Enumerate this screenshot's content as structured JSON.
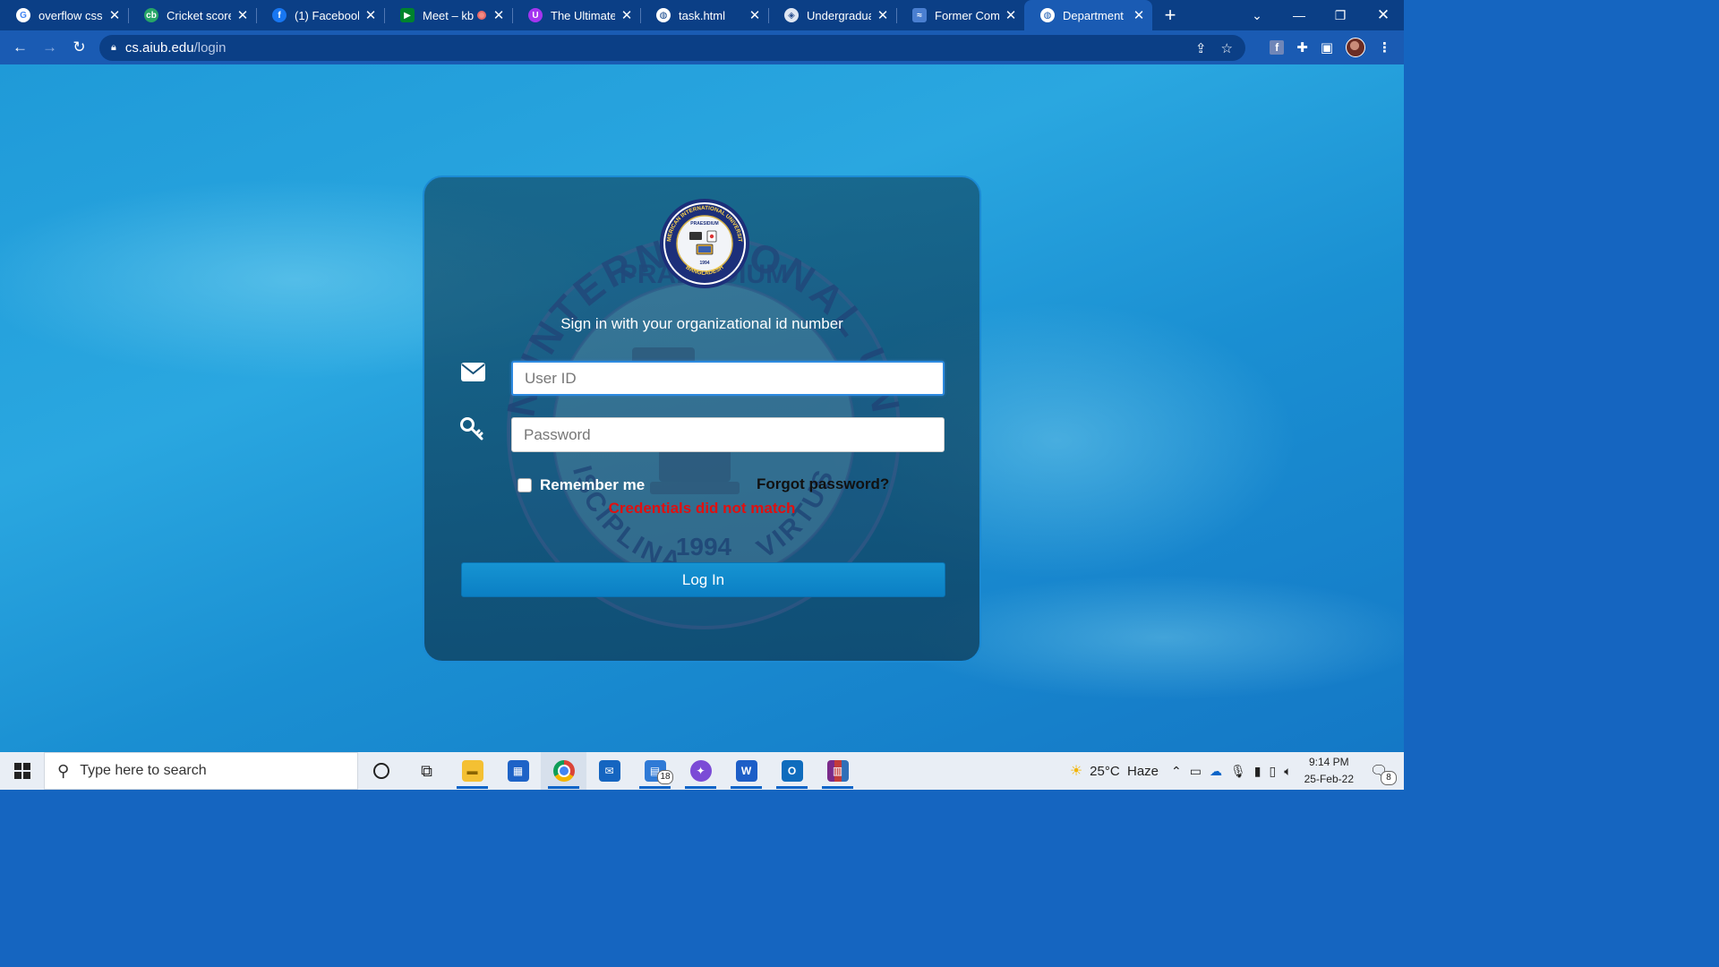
{
  "browser": {
    "tabs": [
      {
        "title": "overflow css -",
        "icon": "google-icon",
        "color": "#ffffff"
      },
      {
        "title": "Cricket scorec",
        "icon": "cricbuzz-icon",
        "color": "#27a567"
      },
      {
        "title": "(1) Facebook",
        "icon": "facebook-icon",
        "color": "#1877f2"
      },
      {
        "title": "Meet – kb",
        "icon": "google-meet-icon",
        "color": "#00832d"
      },
      {
        "title": "The Ultimate 2",
        "icon": "udemy-icon",
        "color": "#a435f0"
      },
      {
        "title": "task.html",
        "icon": "globe-icon",
        "color": "#ffffff"
      },
      {
        "title": "Undergraduat",
        "icon": "university-icon",
        "color": "#dfe6f2"
      },
      {
        "title": "Former Comm",
        "icon": "site-icon",
        "color": "#4a7fd1"
      },
      {
        "title": "Department o",
        "icon": "globe-icon",
        "color": "#ffffff",
        "active": true
      }
    ],
    "url_host": "cs.aiub.edu",
    "url_path": "/login"
  },
  "login": {
    "subtitle": "Sign in with your organizational id number",
    "user_placeholder": "User ID",
    "password_placeholder": "Password",
    "remember_label": "Remember me",
    "forgot_label": "Forgot password?",
    "error_message": "Credentials did not match",
    "login_button": "Log In",
    "logo_text_top": "AMERICAN INTERNATIONAL UNIVERSITY",
    "logo_text_bottom": "BANGLADESH",
    "logo_motto": "PRAESIDIUM",
    "logo_year": "1994",
    "logo_left": "DISCIPLINA",
    "logo_right": "VIRTUS"
  },
  "taskbar": {
    "search_placeholder": "Type here to search",
    "weather": "25°C  Haze",
    "time": "9:14 PM",
    "date": "25-Feb-22",
    "files_badge": "18",
    "notif_badge": "8"
  },
  "colors": {
    "chrome_dark": "#0b3f86",
    "chrome_light": "#1a5bb3",
    "error": "#e01010",
    "button": "#1694d2"
  }
}
